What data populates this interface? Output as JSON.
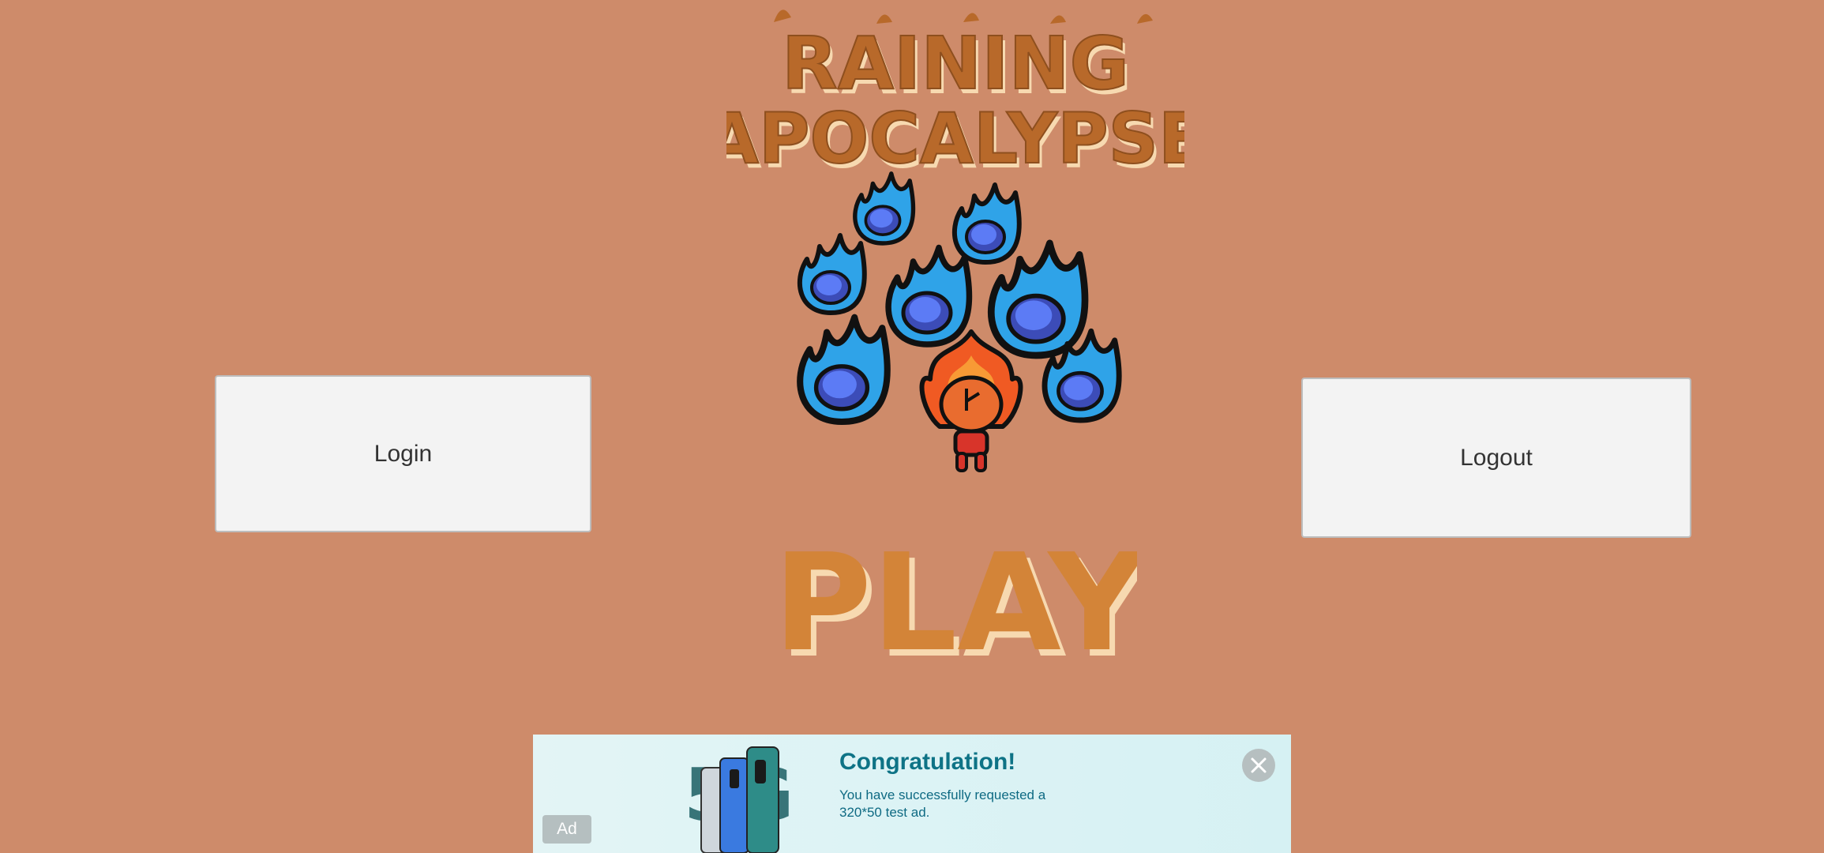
{
  "game": {
    "title_line1": "RAINING",
    "title_line2": "APOCALYPSE",
    "play_label": "PLAY"
  },
  "buttons": {
    "login_label": "Login",
    "logout_label": "Logout"
  },
  "ad": {
    "badge": "Ad",
    "headline": "Congratulation!",
    "body": "You have successfully requested a 320*50 test ad.",
    "graphic_label": "5G"
  },
  "colors": {
    "background": "#CE8B6A",
    "title_orange": "#B8692A",
    "play_orange": "#D38438",
    "highlight_cream": "#F7D9B0",
    "fireball_blue": "#2FA3E8",
    "fireball_core": "#4F6CF2",
    "button_bg": "#F3F3F3",
    "ad_teal": "#0E7386"
  },
  "icons": {
    "close": "close-icon",
    "hero": "fire-character-icon",
    "fireballs": "blue-fireball-icon"
  }
}
